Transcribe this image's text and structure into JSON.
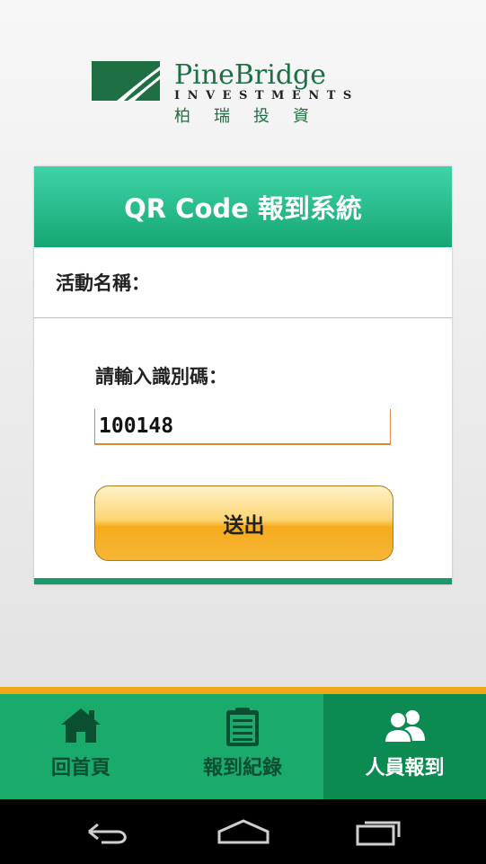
{
  "brand": {
    "name_top": "PineBridge",
    "name_mid": "INVESTMENTS",
    "name_cn": "柏瑞投資"
  },
  "card": {
    "title": "QR Code 報到系統",
    "event_label": "活動名稱：",
    "id_label": "請輸入識別碼：",
    "id_value": "100148",
    "submit_label": "送出"
  },
  "tabs": [
    {
      "label": "回首頁",
      "icon": "home-icon"
    },
    {
      "label": "報到紀錄",
      "icon": "clipboard-icon"
    },
    {
      "label": "人員報到",
      "icon": "people-icon",
      "active": true
    }
  ],
  "colors": {
    "header_top": "#3ed3a8",
    "header_bottom": "#16a673",
    "tabbar": "#1aaa6c",
    "tab_active": "#0b8a52",
    "accent": "#f0a818",
    "button": "#fcd673"
  }
}
